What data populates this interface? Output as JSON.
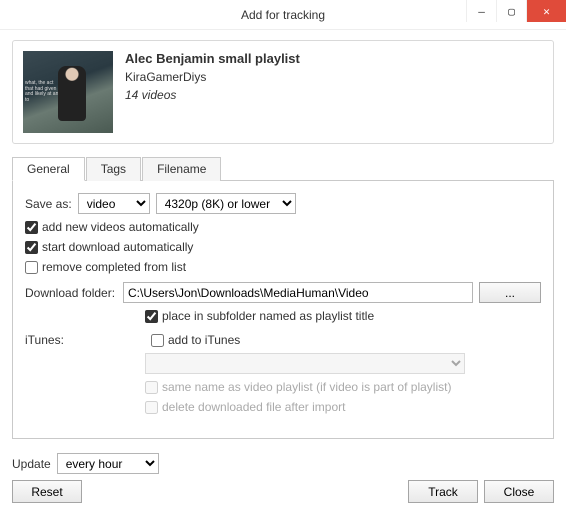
{
  "window": {
    "title": "Add for tracking",
    "minimize": "—",
    "maximize": "▢",
    "close": "✕"
  },
  "header": {
    "title": "Alec Benjamin small playlist",
    "channel": "KiraGamerDiys",
    "count": "14 videos",
    "thumb_caption": "what, the act that had given and likely at an to"
  },
  "tabs": {
    "general": "General",
    "tags": "Tags",
    "filename": "Filename"
  },
  "general": {
    "save_as_label": "Save as:",
    "format_value": "video",
    "quality_value": "4320p (8K) or lower",
    "add_new_label": "add new videos automatically",
    "start_download_label": "start download automatically",
    "remove_completed_label": "remove completed from list",
    "download_folder_label": "Download folder:",
    "download_folder_value": "C:\\Users\\Jon\\Downloads\\MediaHuman\\Video",
    "browse_label": "...",
    "place_subfolder_label": "place in subfolder named as playlist title",
    "itunes_label": "iTunes:",
    "add_itunes_label": "add to iTunes",
    "itunes_playlist_value": "",
    "same_name_label": "same name as video playlist (if video is part of playlist)",
    "delete_after_label": "delete downloaded file after import"
  },
  "footer": {
    "update_label": "Update",
    "update_value": "every hour",
    "reset": "Reset",
    "track": "Track",
    "close": "Close"
  }
}
